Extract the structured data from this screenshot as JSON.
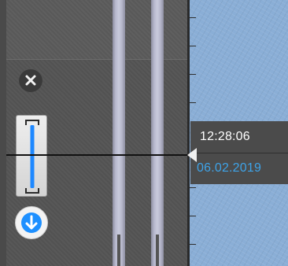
{
  "timeline": {
    "time": "12:28:06",
    "date": "06.02.2019"
  },
  "controls": {
    "close_icon": "close-icon",
    "range_icon": "range-bracket-icon",
    "down_icon": "arrow-down-icon"
  },
  "colors": {
    "date_text": "#3ea3e8",
    "time_text": "#ffffff",
    "range_bar": "#1e88ff",
    "down_arrow": "#1e90ff",
    "timeline_bg": "#8aaed6",
    "panel_bg": "#555555"
  }
}
